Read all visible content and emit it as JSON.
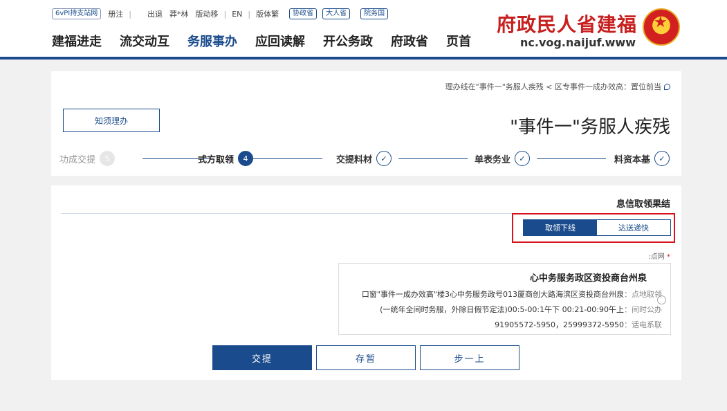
{
  "site": {
    "title": "福建省人民政府",
    "domain": "www.fujian.gov.cn"
  },
  "topbar": {
    "ipv6": "网站支持IPv6",
    "register": "注册",
    "logout": "退出",
    "user": "林*莽",
    "mobile": "移动版",
    "en": "EN",
    "traditional": "繁体版",
    "dept_link": "省政协",
    "npc_link": "省人大",
    "state_council": "国务院"
  },
  "nav": {
    "items": [
      "走进福建",
      "互动交流",
      "办事服务",
      "解读回应",
      "政务公开",
      "省政府",
      "首页"
    ]
  },
  "breadcrumb": "当前位置：高效办成一件事专区 > 残疾人服务\"一件事\"在线办理",
  "page_title": "残疾人服务\"一件事\"",
  "guide_button": "办理须知",
  "steps": [
    {
      "num": "",
      "label": "基本资料"
    },
    {
      "num": "",
      "label": "业务表单"
    },
    {
      "num": "",
      "label": "材料提交"
    },
    {
      "num": "4",
      "label": "领取方式"
    },
    {
      "num": "5",
      "label": "提交成功"
    }
  ],
  "section_title": "结果领取信息",
  "toggle": {
    "offline": "线下领取",
    "express": "快递送达"
  },
  "network_label": "网点:",
  "service_center": {
    "name": "泉州台商投资区政务服务中心",
    "address_label": "领取地点：",
    "address": "泉州台商投资区滨海路大创商厦310号政务服务中心3楼\"高效办成一件事\"窗口",
    "hours_label": "办公时间：",
    "hours": "上午09:00-12:00 下午1:00-5:00(法定节假日除外，服务时间全年统一)",
    "phone_label": "联系电话：",
    "phone": "0595-27399952，0595-27550919"
  },
  "buttons": {
    "submit": "提交",
    "save": "暂存",
    "prev": "上一步"
  },
  "colors": {
    "brand_blue": "#1a4b8c",
    "highlight_red": "#d7141b",
    "title_red": "#c81f1f"
  }
}
